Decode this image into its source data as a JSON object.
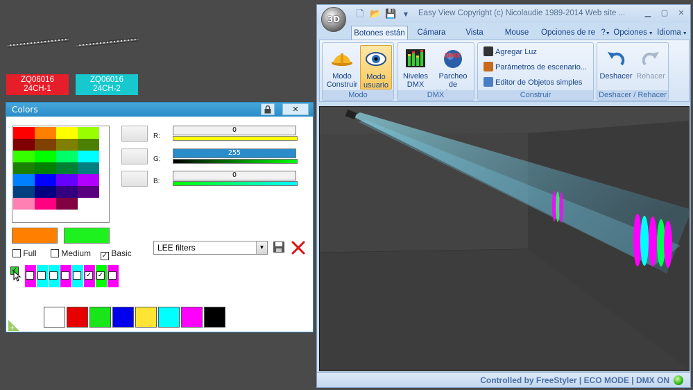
{
  "desktop": {
    "fixtures": [
      {
        "id_label": "ZQ06016",
        "channel_label": "24CH-1",
        "color": "#e61e2a"
      },
      {
        "id_label": "ZQ06016",
        "channel_label": "24CH-2",
        "color": "#17c9cf"
      }
    ]
  },
  "colors_window": {
    "title": "Colors",
    "palette": [
      [
        "#ff0000",
        "#ff8000",
        "#ffff00",
        "#99ff00"
      ],
      [
        "#800000",
        "#804000",
        "#808000",
        "#4c8000"
      ],
      [
        "#33ff00",
        "#00ff00",
        "#00ff66",
        "#00ffff"
      ],
      [
        "#1a8000",
        "#008000",
        "#008033",
        "#008080"
      ],
      [
        "#0080ff",
        "#0000ff",
        "#6600ff",
        "#b200ff"
      ],
      [
        "#004080",
        "#000080",
        "#330080",
        "#590080"
      ],
      [
        "#ff80b3",
        "#ff0080",
        "#800040",
        "#ffffff"
      ]
    ],
    "rgb": {
      "r_label": "R:",
      "r_value": "0",
      "g_label": "G:",
      "g_value": "255",
      "b_label": "B:",
      "b_value": "0"
    },
    "primary_color": "#ff8000",
    "secondary_color": "#1ef21e",
    "palette_options": {
      "full_label": "Full",
      "medium_label": "Medium",
      "basic_label": "Basic",
      "basic_checked": true
    },
    "filter_select": {
      "value": "LEE filters"
    },
    "channel_cells": [
      {
        "color": "#ff00ff",
        "checked": false
      },
      {
        "color": "#00ffff",
        "checked": false
      },
      {
        "color": "#00ffff",
        "checked": false
      },
      {
        "color": "#ff00ff",
        "checked": false
      },
      {
        "color": "#00ffff",
        "checked": false
      },
      {
        "color": "#ff00ff",
        "checked": true
      },
      {
        "color": "#00ff00",
        "checked": true
      },
      {
        "color": "#ff00ff",
        "checked": false
      }
    ],
    "basic_colors": [
      "#ffffff",
      "#e60000",
      "#19e619",
      "#0000ee",
      "#ffe433",
      "#00ffff",
      "#ff00ff",
      "#000000"
    ]
  },
  "app_window": {
    "title": "Easy View   Copyright (c) Nicolaudie 1989-2014    Web site ...",
    "orb_label": "3D",
    "tabs": [
      "Botones están",
      "Cámara",
      "Vista",
      "Mouse",
      "Opciones de re"
    ],
    "right_menu": {
      "help": "?",
      "options": "Opciones",
      "language": "Idioma"
    },
    "ribbon": {
      "modo": {
        "label": "Modo",
        "construir": "Modo Construir",
        "usuario": "Modo usuario"
      },
      "dmx": {
        "label": "DMX",
        "niveles": "Niveles DMX",
        "parcheo": "Parcheo de Universos"
      },
      "construir": {
        "label": "Construir",
        "agregar": "Agregar Luz",
        "parametros": "Parámetros de escenario...",
        "editor": "Editor de Objetos simples"
      },
      "deshacer": {
        "label": "Deshacer / Rehacer",
        "undo": "Deshacer",
        "redo": "Rehacer"
      }
    },
    "status": "Controlled by FreeStyler   |   ECO MODE   |   DMX ON"
  }
}
